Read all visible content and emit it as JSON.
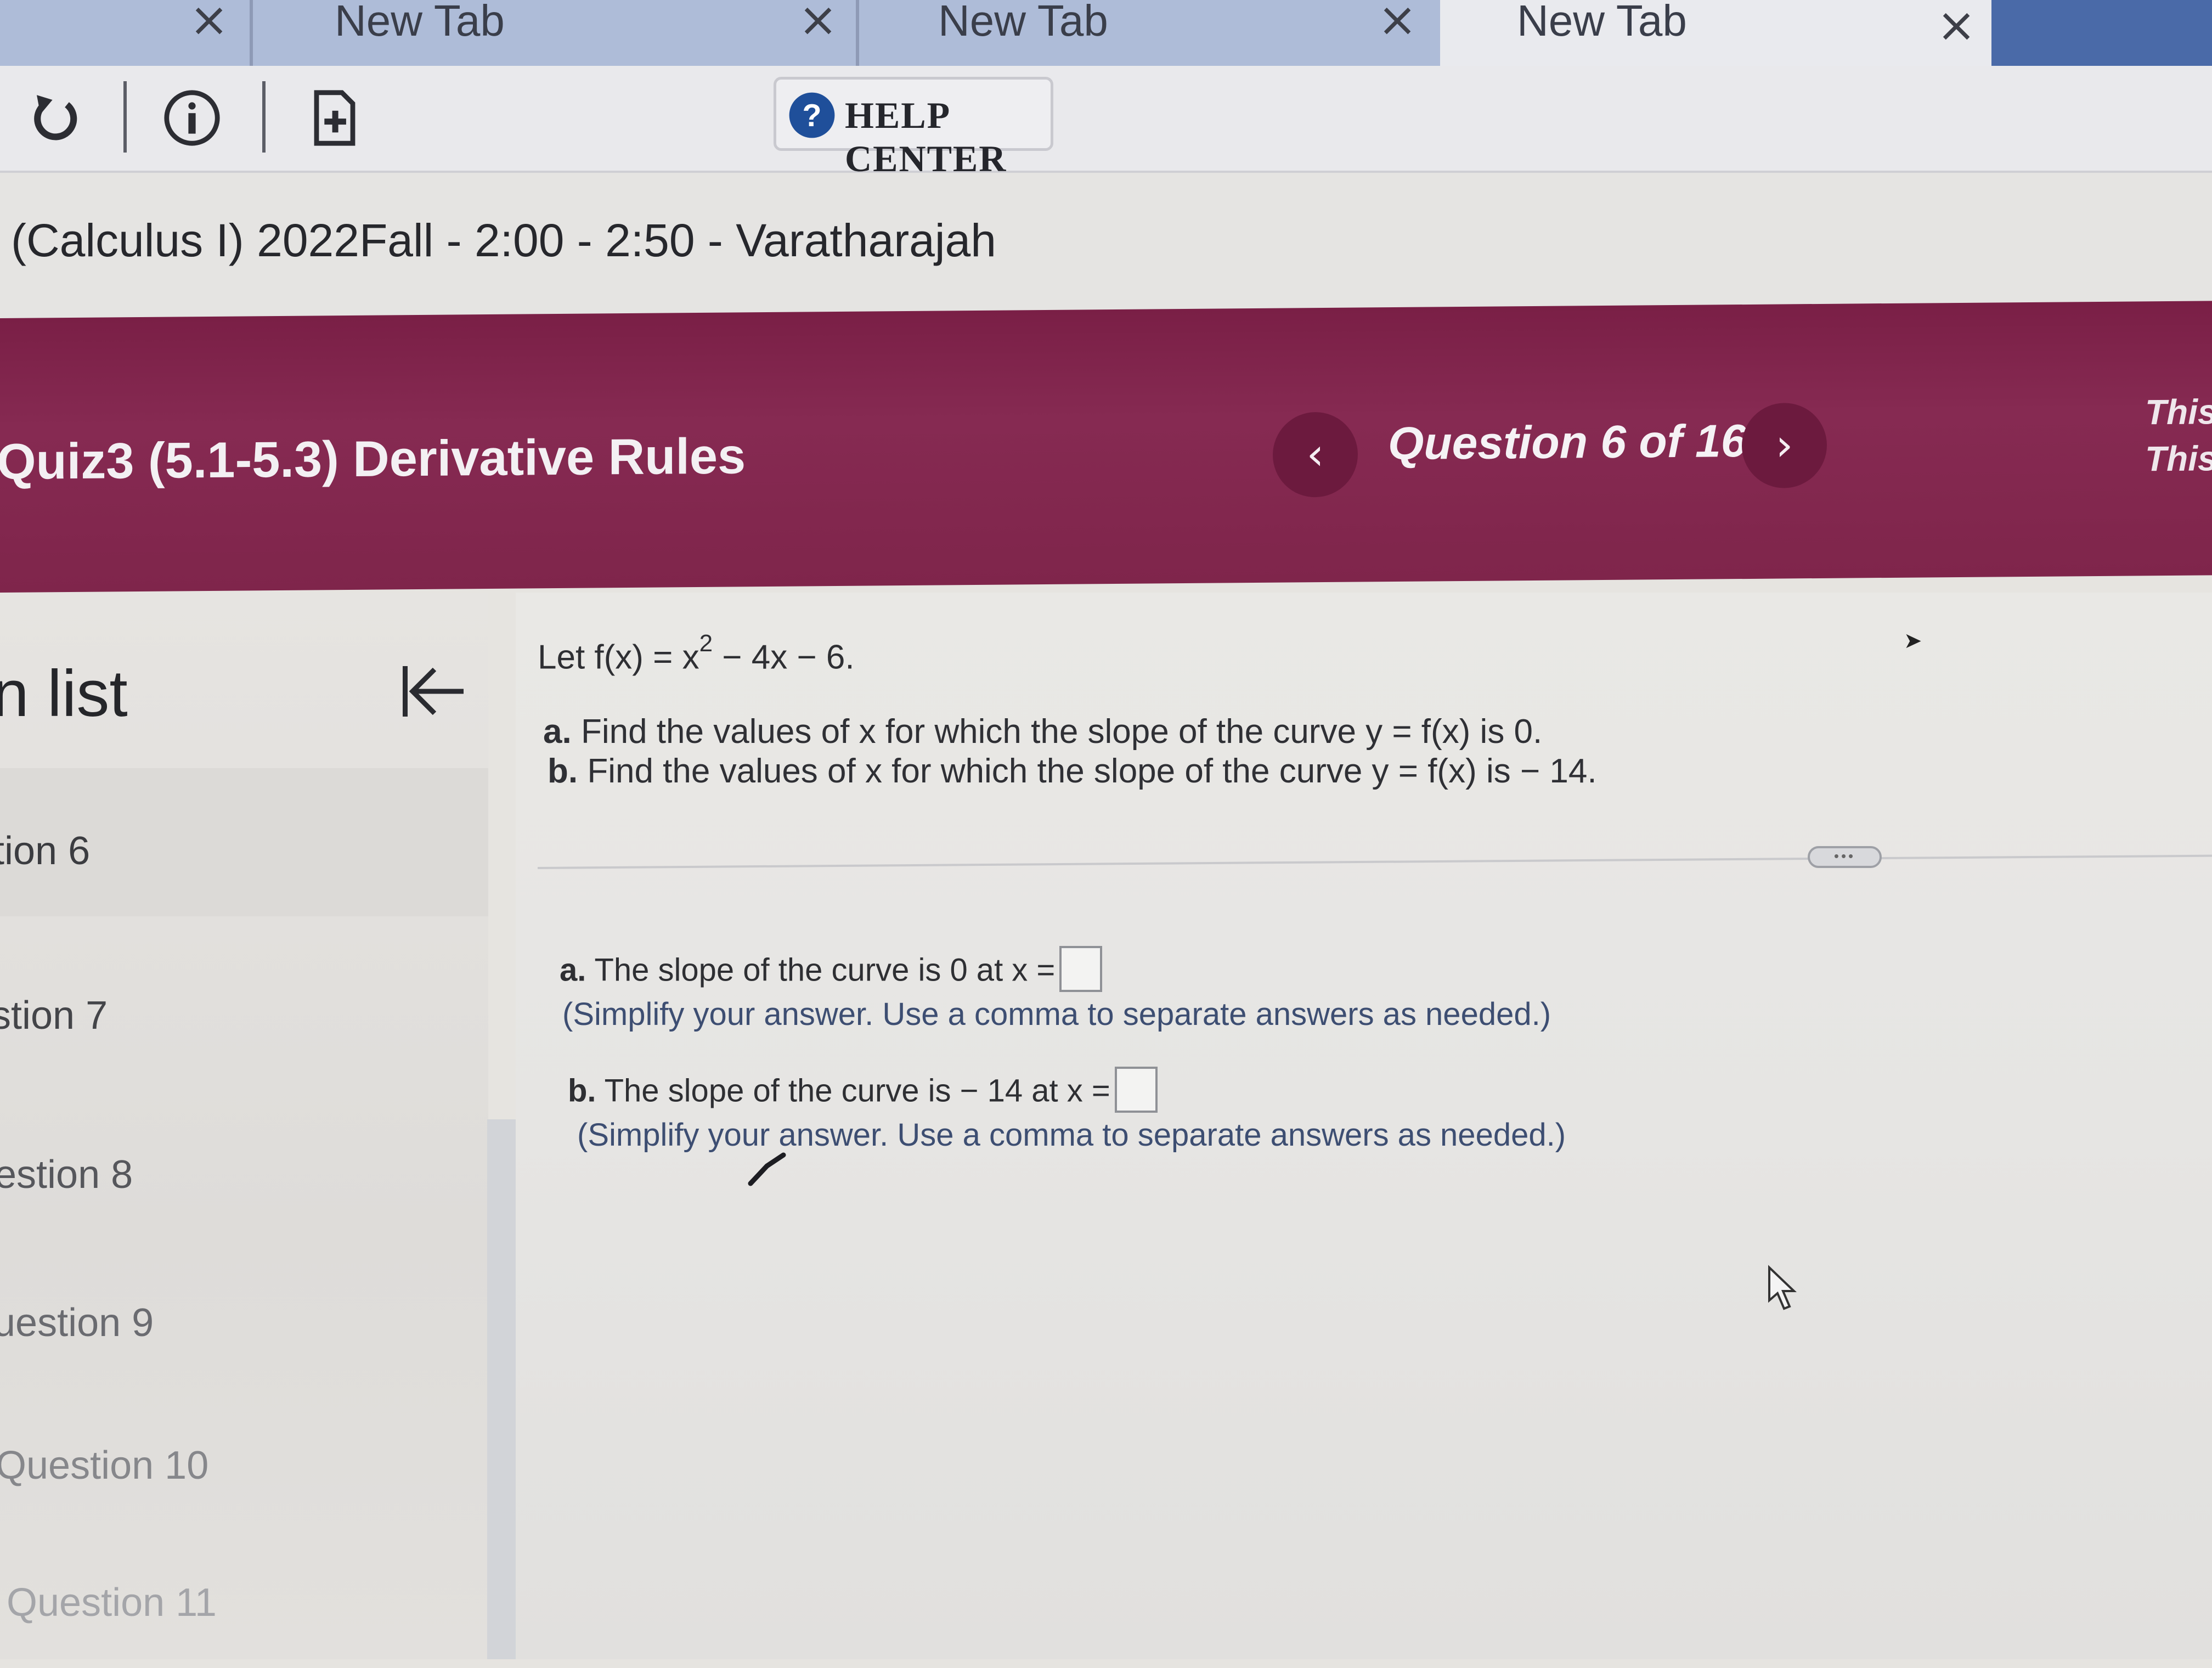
{
  "browser": {
    "tabs": [
      {
        "title": "New Tab",
        "close": "×"
      },
      {
        "title": "New Tab",
        "close": "×"
      },
      {
        "title": "New Tab",
        "close": "×"
      }
    ],
    "first_close": "×"
  },
  "toolbar": {
    "help_center_label": "HELP CENTER",
    "help_glyph": "?"
  },
  "course": {
    "title": "(Calculus I) 2022Fall - 2:00 - 2:50 - Varatharajah"
  },
  "quiz": {
    "title": "Quiz3 (5.1-5.3) Derivative Rules",
    "prev_arrow": "‹",
    "next_arrow": "›",
    "counter": "Question 6 of 16",
    "side_text_1": "This",
    "side_text_2": "This"
  },
  "sidebar": {
    "heading": "n list",
    "scroll_arrow": "▲",
    "items": [
      {
        "label": "tion 6"
      },
      {
        "label": "stion 7"
      },
      {
        "label": "estion 8"
      },
      {
        "label": "uestion 9"
      },
      {
        "label": "Question 10"
      },
      {
        "label": "Question 11"
      }
    ]
  },
  "question": {
    "stem_prefix": "Let f(x) = x",
    "stem_exponent": "2",
    "stem_suffix": " − 4x − 6.",
    "part_a_letter": "a.",
    "part_a_text": " Find the values of x for which the slope of the curve y = f(x) is 0.",
    "part_b_letter": "b.",
    "part_b_text": " Find the values of x for which the slope of the curve y = f(x) is  − 14.",
    "more_label": "•••"
  },
  "answers": {
    "a_letter": "a.",
    "a_text": " The slope of the curve is 0 at x =",
    "a_value": "",
    "a_hint": "(Simplify your answer. Use a comma to separate answers as needed.)",
    "b_letter": "b.",
    "b_text": " The slope of the curve is  − 14 at x =",
    "b_value": "",
    "b_hint": "(Simplify your answer. Use a comma to separate answers as needed.)"
  },
  "colors": {
    "banner": "#7f254b",
    "hint_text": "#3d4e72",
    "tab_strip": "#aebcd8"
  }
}
